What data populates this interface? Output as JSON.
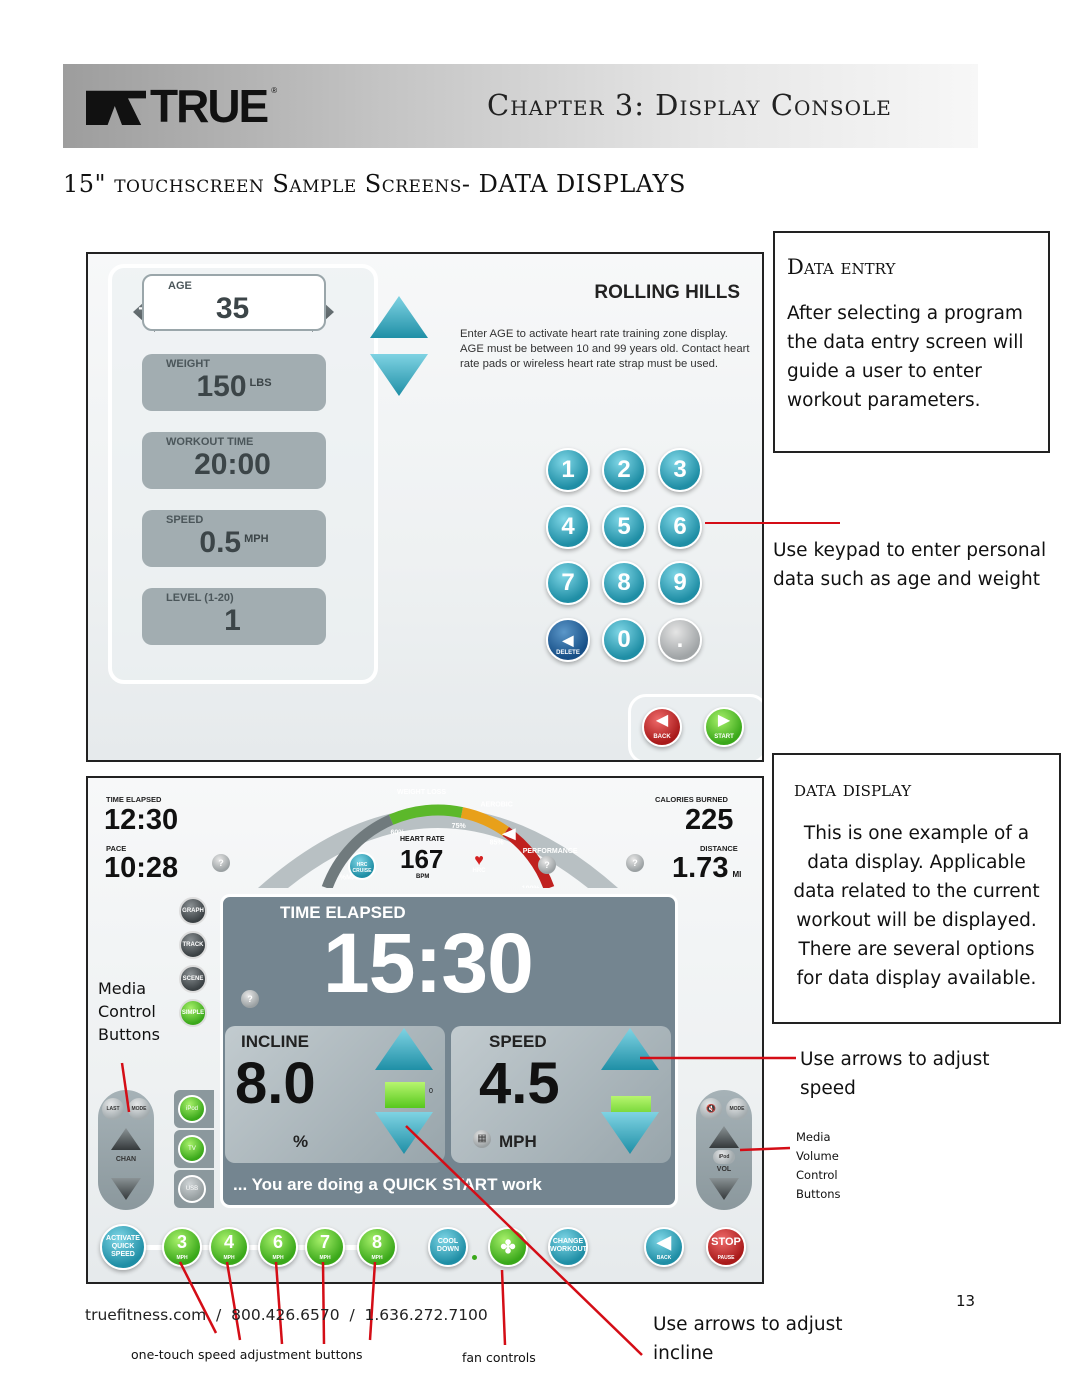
{
  "header": {
    "brand": "TRUE",
    "chapter_title": "Chapter 3: Display Console"
  },
  "section_title": "15\" touchscreen Sample Screens- DATA DISPLAYS",
  "data_entry_screen": {
    "fields": [
      {
        "label": "AGE",
        "value": "35",
        "unit": "",
        "active": true
      },
      {
        "label": "WEIGHT",
        "value": "150",
        "unit": "LBS",
        "active": false
      },
      {
        "label": "WORKOUT TIME",
        "value": "20:00",
        "unit": "",
        "active": false
      },
      {
        "label": "SPEED",
        "value": "0.5",
        "unit": "MPH",
        "active": false
      },
      {
        "label": "LEVEL (1-20)",
        "value": "1",
        "unit": "",
        "active": false
      }
    ],
    "age_minus": "−",
    "age_plus": "+",
    "program_title": "ROLLING HILLS",
    "program_description": "Enter AGE to activate heart rate training zone display. AGE must be between 10 and 99 years old. Contact heart rate pads or wireless heart rate strap must be used.",
    "keypad": [
      "1",
      "2",
      "3",
      "4",
      "5",
      "6",
      "7",
      "8",
      "9",
      "◀",
      "0",
      "."
    ],
    "delete_label": "DELETE",
    "back_label": "BACK",
    "start_label": "START"
  },
  "data_entry_box": {
    "title": "Data entry",
    "body": "After selecting a program the data entry screen will guide a user to enter workout parameters."
  },
  "keypad_note": "Use keypad to enter personal data such as age and weight",
  "data_display_screen": {
    "time_elapsed_label": "TIME ELAPSED",
    "time_elapsed_value": "12:30",
    "pace_label": "PACE",
    "pace_value": "10:28",
    "calories_label": "CALORIES BURNED",
    "calories_value": "225",
    "distance_label": "DISTANCE",
    "distance_value": "1.73",
    "distance_unit": "MI",
    "gauge": {
      "zones": [
        "WEIGHT LOSS",
        "AEROBIC",
        "PERFORMANCE"
      ],
      "marks": [
        "%MAX",
        "60%",
        "75%",
        "85%",
        "100%"
      ],
      "heart_rate_label": "HEART RATE",
      "heart_rate_value": "167",
      "heart_rate_unit": "BPM",
      "hrc_cruise": "HRC CRUISE",
      "hrc": "HRC",
      "current_percent_max": 86,
      "colors": {
        "neutral": "#707a7d",
        "weight_loss": "#5cb82a",
        "aerobic": "#e8a01a",
        "performance": "#c0211f"
      }
    },
    "view_buttons": [
      "GRAPH",
      "TRACK",
      "SCENE",
      "SIMPLE"
    ],
    "active_view": "SIMPLE",
    "main_label": "TIME ELAPSED",
    "main_value": "15:30",
    "incline_label": "INCLINE",
    "incline_value": "8.0",
    "incline_unit": "%",
    "incline_level_mark": "0",
    "speed_label": "SPEED",
    "speed_value": "4.5",
    "speed_unit": "MPH",
    "scroll_message": "... You are doing a QUICK START work",
    "channel_remote": {
      "last": "LAST",
      "mode": "MODE",
      "label": "CHAN"
    },
    "volume_remote": {
      "mute": "🔇",
      "mode": "MODE",
      "source": "iPod",
      "label": "VOL"
    },
    "sources": [
      "iPod",
      "TV",
      "USB"
    ],
    "quick_speed": {
      "activate_label": "ACTIVATE QUICK SPEED",
      "speeds": [
        "3",
        "4",
        "6",
        "7",
        "8"
      ],
      "unit": "MPH"
    },
    "cool_down_label": "COOL DOWN",
    "change_workout_label": "CHANGE WORKOUT",
    "back_label": "BACK",
    "stop_label": "STOP",
    "pause_label": "PAUSE"
  },
  "data_display_box": {
    "title": "data display",
    "body": "This is one example of a data display. Applicable data related to the current workout will be displayed. There are several options for data display available."
  },
  "annotations": {
    "media_control": "Media Control Buttons",
    "speed_arrows": "Use arrows to adjust speed",
    "media_volume": "Media Volume Control Buttons",
    "incline_arrows": "Use arrows to adjust incline",
    "one_touch": "one-touch speed adjustment buttons",
    "fan_controls": "fan controls"
  },
  "footer": {
    "contact": "truefitness.com  /  800.426.6570  /  1.636.272.7100",
    "page_number": "13"
  }
}
